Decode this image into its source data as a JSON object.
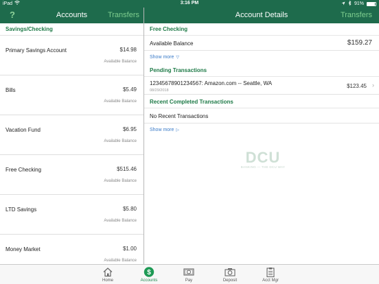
{
  "status_bar": {
    "device": "iPad",
    "time": "3:16 PM",
    "battery_percent": "91%",
    "battery_level": 0.91
  },
  "left_nav": {
    "help_label": "?",
    "title": "Accounts",
    "transfers_label": "Transfers"
  },
  "right_nav": {
    "title": "Account Details",
    "transfers_label": "Transfers"
  },
  "accounts": {
    "section_title": "Savings/Checking",
    "items": [
      {
        "name": "Primary Savings Account",
        "amount": "$14.98",
        "sub": "Available Balance"
      },
      {
        "name": "Bills",
        "amount": "$5.49",
        "sub": "Available Balance"
      },
      {
        "name": "Vacation Fund",
        "amount": "$6.95",
        "sub": "Available Balance"
      },
      {
        "name": "Free Checking",
        "amount": "$515.46",
        "sub": "Available Balance"
      },
      {
        "name": "LTD Savings",
        "amount": "$5.80",
        "sub": "Available Balance"
      },
      {
        "name": "Money Market",
        "amount": "$1.00",
        "sub": "Available Balance"
      }
    ]
  },
  "details": {
    "account_title": "Free Checking",
    "balance_label": "Available Balance",
    "balance_value": "$159.27",
    "show_more_label": "Show more",
    "pending_title": "Pending Transactions",
    "pending": [
      {
        "description": "12345678901234567: Amazon.com -- Seattle, WA",
        "date": "08/29/2018",
        "amount": "$123.45"
      }
    ],
    "completed_title": "Recent Completed Transactions",
    "no_recent_text": "No Recent Transactions",
    "show_more_label_2": "Show more"
  },
  "watermark": {
    "logo_text": "DCU",
    "tagline": "BANKING — THE DCU WAY"
  },
  "tabbar": {
    "tabs": [
      {
        "label": "Home",
        "icon": "home-icon"
      },
      {
        "label": "Accounts",
        "icon": "dollar-icon",
        "active": true
      },
      {
        "label": "Pay",
        "icon": "pay-icon"
      },
      {
        "label": "Deposit",
        "icon": "camera-icon"
      },
      {
        "label": "Acct Mgr",
        "icon": "clipboard-icon"
      }
    ]
  },
  "colors": {
    "brand_green": "#1e6b4c",
    "accent_green": "#1e7a47",
    "link_blue": "#3a7bc8"
  }
}
